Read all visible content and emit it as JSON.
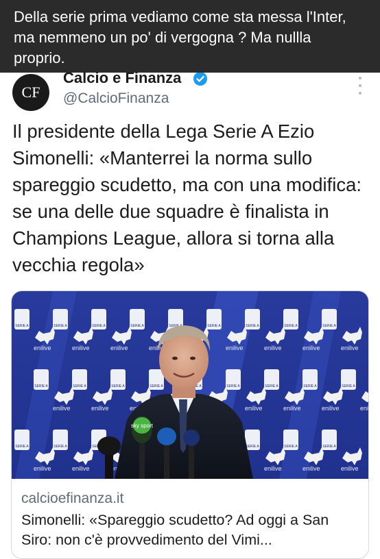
{
  "overlay": {
    "comment": "Della serie prima vediamo come sta messa l'Inter, ma nemmeno un po' di vergogna ? Ma nullla proprio."
  },
  "tweet": {
    "avatar_text": "CF",
    "display_name": "Calcio e Finanza",
    "verified_icon": "verified-badge-icon",
    "handle": "@CalcioFinanza",
    "more_icon": "more-vertical-icon",
    "text": "Il presidente della Lega Serie A Ezio Simonelli: «Manterrei la norma sullo spareggio scudetto, ma con una modifica: se una delle due squadre è finalista in Champions League, allora si torna alla vecchia regola»"
  },
  "card": {
    "image_alt": "Press conference photo with Serie A and enilive branded backdrop",
    "backdrop_brand": "enilive",
    "backdrop_logo": "SERIE A",
    "microphone_labels": [
      "sky sport"
    ],
    "domain": "calcioefinanza.it",
    "title": "Simonelli: «Spareggio scudetto? Ad oggi a San Siro: non c'è provvedimento del Vimi..."
  },
  "colors": {
    "overlay_bg": "#2b2b2b",
    "verified_blue": "#1d9bf0",
    "backdrop_blue": "#24359a",
    "secondary_text": "#5f6b76"
  }
}
